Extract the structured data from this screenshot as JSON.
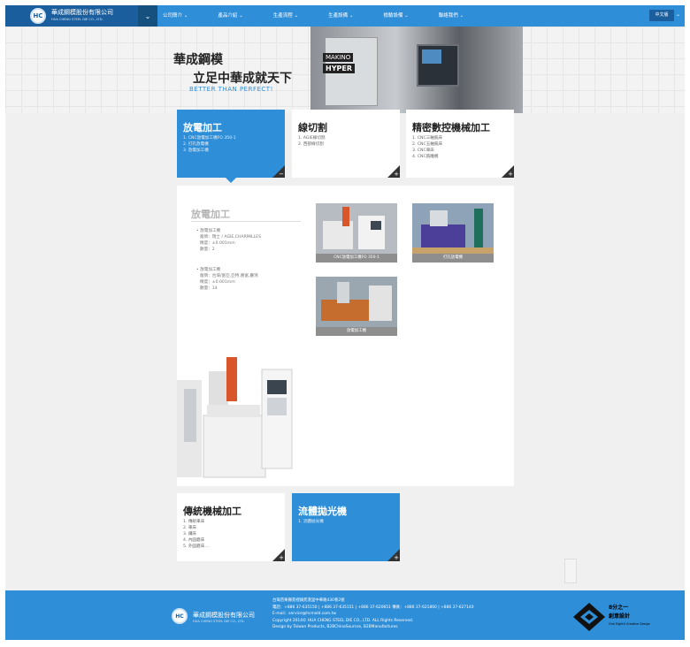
{
  "header": {
    "logo_mark": "HC",
    "company_name": "華成鋼模股份有限公司",
    "company_en": "HUA CHENG STEEL DIE CO., LTD.",
    "menu_toggle": "⌄",
    "nav": [
      "公司簡介 ⌄",
      "產品介紹 ⌄",
      "生產流程 ⌄",
      "生產設備 ⌄",
      "檢驗設備 ⌄",
      "聯絡我們 ⌄"
    ],
    "language": "中文版",
    "language_caret": "⌄"
  },
  "hero": {
    "title_line1": "華成鋼模",
    "title_line2": "立足中華成就天下",
    "slogan": "BETTER THAN PERFECT!",
    "machine_brand": "MAKINO",
    "machine_model": "HYPER"
  },
  "cards_top": [
    {
      "title": "放電加工",
      "items": [
        "1. CNC放電加工機FO 350-1",
        "2. 打孔放電機",
        "3. 放電加工機"
      ],
      "corner": "−",
      "active": true
    },
    {
      "title": "線切割",
      "items": [
        "1. AGIE線切割",
        "2. 西部線切割"
      ],
      "corner": "+",
      "active": false
    },
    {
      "title": "精密數控機械加工",
      "items": [
        "1. CNC三軸銑床",
        "2. CNC五軸銑床",
        "3. CNC車床",
        "4. CNC銑雕機"
      ],
      "corner": "+",
      "active": false
    }
  ],
  "detail": {
    "heading": "放電加工",
    "spec1": [
      "• 放電加工機",
      "廠牌：瑞士 / AGIE,CHARMILLES",
      "精度：±0.001mm",
      "數量：2"
    ],
    "spec2": [
      "• 放電加工機",
      "廠牌：台灣/富亞,亞特,勝富,慶鴻",
      "精度：±0.001mm",
      "數量：14"
    ],
    "thumbs": [
      "CNC放電加工機FO 350-1",
      "打孔放電機",
      "放電加工機"
    ]
  },
  "cards_bottom": [
    {
      "title": "傳統機械加工",
      "items": [
        "1. 傳統車床",
        "2. 車床",
        "3. 鑽床",
        "4. 內圓磨床",
        "5. 外圓磨床...."
      ],
      "corner": "+",
      "active": false
    },
    {
      "title": "流體拋光機",
      "items": [
        "1. 流體拋光機"
      ],
      "corner": "+",
      "active": true
    }
  ],
  "footer": {
    "logo_mark": "HC",
    "company_name": "華成鋼模股份有限公司",
    "company_en": "HUA CHENG STEEL DIE CO., LTD.",
    "lines": [
      "台灣苗栗縣苑裡鎮苑港里中華路430巷2號",
      "電話：+886 37-635150 | +886 37-635151 | +886 37-620651    傳真：+886 37-621860 | +886 37-627140",
      "E-mail：service@hcmold.com.tw",
      "Copyright 2014© HUA CHENG STEEL DIE CO., LTD. ALL Rights Reserved.",
      "Design by Taiwan Products, B2BChinaSources, B2BManufactures"
    ],
    "brand_name1": "8分之一",
    "brand_name2": "創意設計",
    "brand_en": "One Eighth Creative Design"
  }
}
